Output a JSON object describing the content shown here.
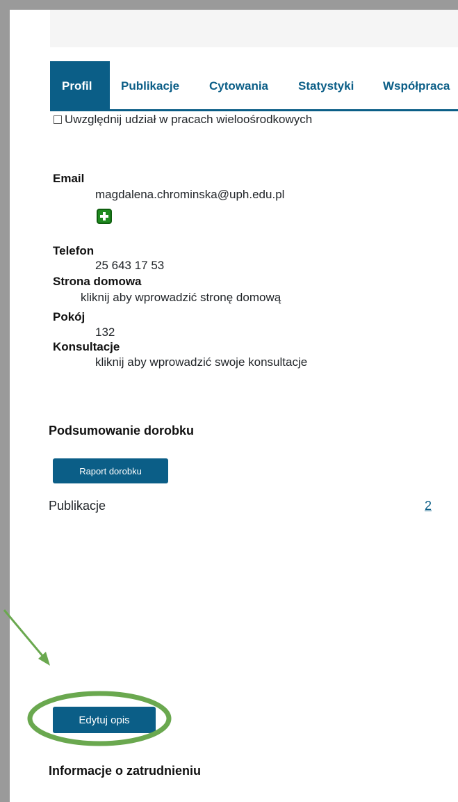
{
  "tabs": [
    "Profil",
    "Publikacje",
    "Cytowania",
    "Statystyki",
    "Współpraca"
  ],
  "active_tab": "Profil",
  "multicenter_checkbox": {
    "label": "Uwzględnij udział w pracach wieloośrodkowych",
    "checked": false
  },
  "contact": {
    "email_label": "Email",
    "email_value": "magdalena.chrominska@uph.edu.pl",
    "add_icon": "plus-icon",
    "phone_label": "Telefon",
    "phone_value": "25 643 17 53",
    "homepage_label": "Strona domowa",
    "homepage_value": "kliknij aby wprowadzić stronę domową",
    "room_label": "Pokój",
    "room_value": "132",
    "consultations_label": "Konsultacje",
    "consultations_value": "kliknij aby wprowadzić swoje konsultacje"
  },
  "summary": {
    "title": "Podsumowanie dorobku",
    "report_button": "Raport dorobku",
    "publications_label": "Publikacje",
    "publications_count": "2"
  },
  "edit_button": "Edytuj opis",
  "employment_title": "Informacje o zatrudnieniu",
  "colors": {
    "primary": "#0b5e87",
    "annotation_green": "#6aa84f",
    "plus_green": "#1f8a1f"
  }
}
